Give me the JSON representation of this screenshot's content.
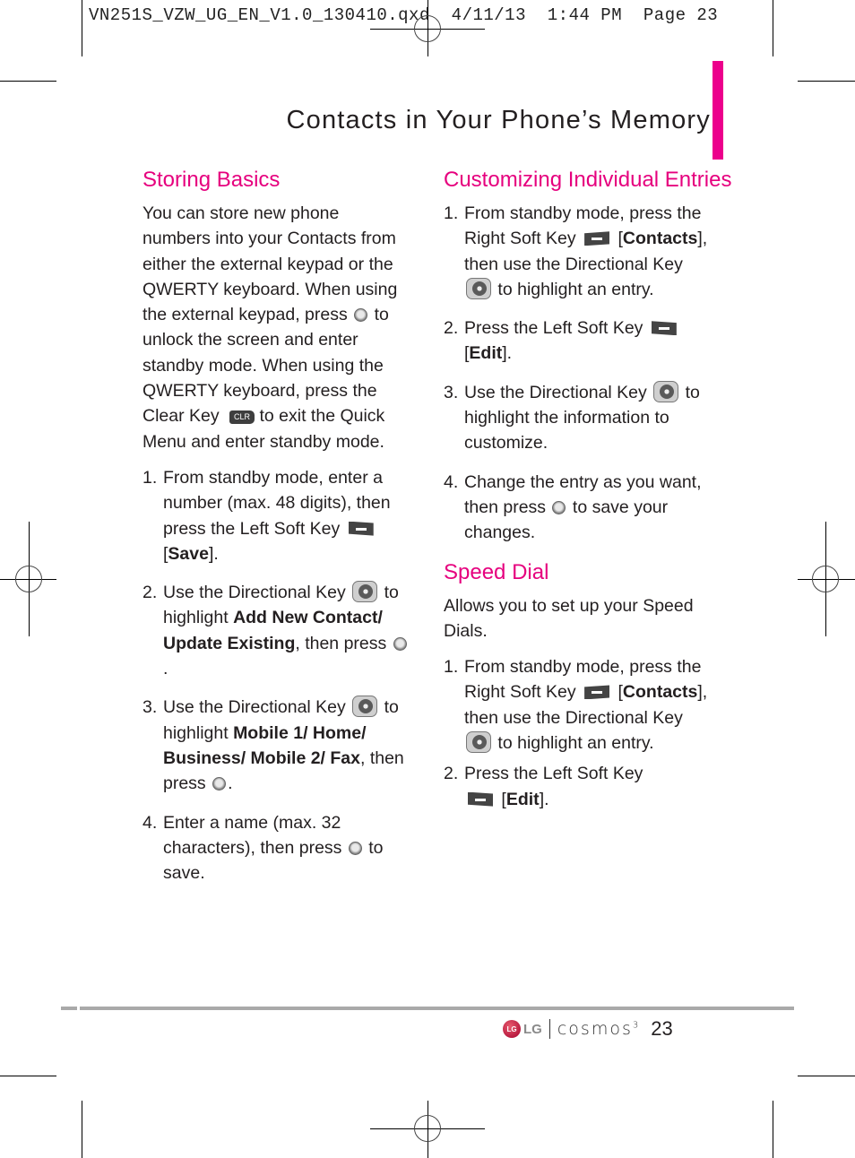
{
  "slug": {
    "text": "VN251S_VZW_UG_EN_V1.0_130410.qxd  4/11/13  1:44 PM  Page 23"
  },
  "header": {
    "title": "Contacts in Your Phone’s Memory",
    "accent_color": "#ec008c"
  },
  "left_column": {
    "heading": "Storing Basics",
    "intro": {
      "part1": "You can store new phone numbers into your Contacts from either the external keypad or the QWERTY keyboard. When using the external keypad, press",
      "part2": "to unlock the screen and enter standby mode. When using the QWERTY keyboard, press the Clear Key",
      "clr_label": "CLR",
      "part3": "to exit the Quick Menu and enter standby mode."
    },
    "steps": [
      {
        "num": "1.",
        "a": "From standby mode, enter a number (max. 48 digits), then press the Left Soft Key",
        "b": "[",
        "bold": "Save",
        "c": "]."
      },
      {
        "num": "2.",
        "a": "Use the Directional Key",
        "b": "to highlight",
        "bold": "Add New Contact/ Update Existing",
        "c": ", then press",
        "d": "."
      },
      {
        "num": "3.",
        "a": "Use the Directional Key",
        "b": "to highlight",
        "bold": "Mobile 1/ Home/ Business/ Mobile 2/ Fax",
        "c": ", then press",
        "d": "."
      },
      {
        "num": "4.",
        "a": "Enter a name (max. 32 characters), then press",
        "b": "to save."
      }
    ]
  },
  "right_column": {
    "customizing": {
      "heading": "Customizing Individual Entries",
      "steps": [
        {
          "num": "1.",
          "a": "From standby mode, press the Right Soft Key",
          "b": "[",
          "bold": "Contacts",
          "c": "], then use the Directional Key",
          "d": "to highlight an entry."
        },
        {
          "num": "2.",
          "a": "Press the Left Soft Key",
          "b": "[",
          "bold": "Edit",
          "c": "]."
        },
        {
          "num": "3.",
          "a": "Use the Directional Key",
          "b": "to highlight the information to customize."
        },
        {
          "num": "4.",
          "a": "Change the entry as you want, then press",
          "b": "to save your changes."
        }
      ]
    },
    "speed_dial": {
      "heading": "Speed Dial",
      "intro": "Allows you to set up your Speed Dials.",
      "steps": [
        {
          "num": "1.",
          "a": "From standby mode, press the Right Soft Key",
          "b": "[",
          "bold": "Contacts",
          "c": "], then use the Directional Key",
          "d": "to highlight an entry."
        },
        {
          "num": "2.",
          "a": "Press the Left Soft Key",
          "b": "[",
          "bold": "Edit",
          "c": "]."
        }
      ]
    }
  },
  "footer": {
    "brand_logo_text": "LG",
    "brand": "LG",
    "product": "cosmos",
    "product_suffix": "3",
    "page_number": "23"
  }
}
